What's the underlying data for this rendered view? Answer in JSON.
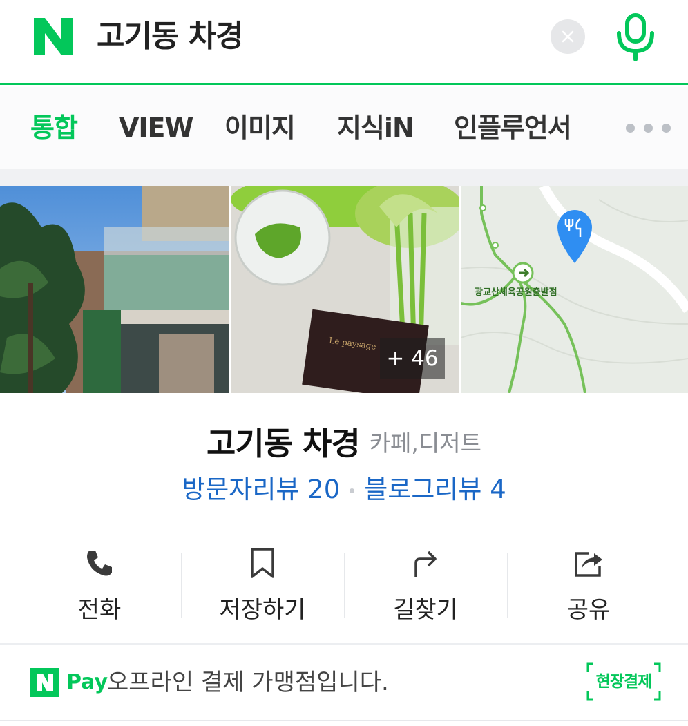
{
  "header": {
    "query": "고기동 차경",
    "brand_color": "#03c75a"
  },
  "tabs": [
    {
      "label": "통합",
      "active": true
    },
    {
      "label": "VIEW",
      "active": false
    },
    {
      "label": "이미지",
      "active": false
    },
    {
      "label": "지식iN",
      "active": false
    },
    {
      "label": "인플루언서",
      "active": false
    }
  ],
  "photos": {
    "more_count": "+ 46",
    "map_label": "광교산체육공원출발점"
  },
  "place": {
    "name": "고기동 차경",
    "category": "카페,디저트",
    "visitor_reviews": "방문자리뷰 20",
    "blog_reviews": "블로그리뷰 4",
    "link_color": "#1a67c6"
  },
  "actions": [
    {
      "label": "전화",
      "icon": "phone-icon"
    },
    {
      "label": "저장하기",
      "icon": "bookmark-icon"
    },
    {
      "label": "길찾기",
      "icon": "directions-icon"
    },
    {
      "label": "공유",
      "icon": "share-icon"
    }
  ],
  "pay": {
    "brand": "Pay",
    "message": "오프라인 결제 가맹점입니다.",
    "badge": "현장결제"
  }
}
